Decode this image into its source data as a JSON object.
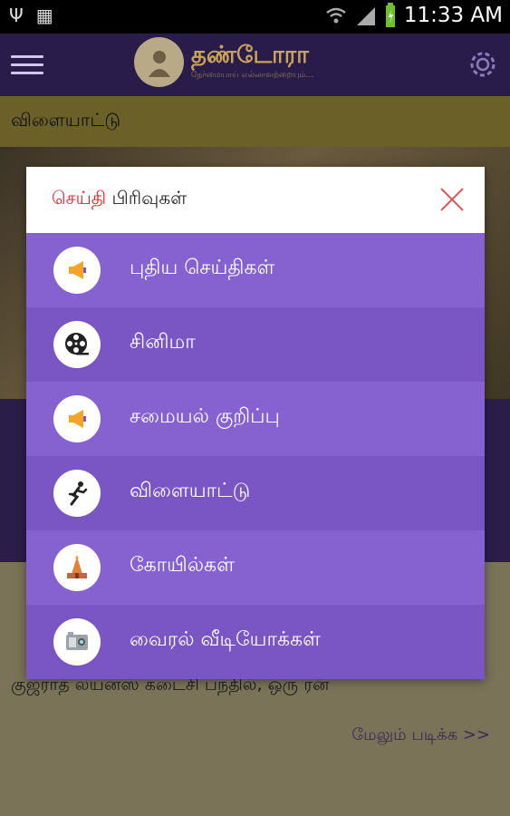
{
  "status_bar": {
    "time": "11:33 AM",
    "icons": [
      "usb-icon",
      "sim-icon",
      "wifi-icon",
      "signal-icon",
      "battery-icon"
    ]
  },
  "app_bar": {
    "logo_title": "தண்டோரா",
    "logo_tagline": "நேர்மையாய் எல்லாவற்றையும்...",
    "menu_icon": "hamburger-icon",
    "settings_icon": "gear-icon"
  },
  "category_bar": {
    "title": "விளையாட்டு"
  },
  "background": {
    "article_line": "குஜராத் லயன்ஸ் கடைசி பந்தில், ஒரு ரன்",
    "read_more": "மேலும் படிக்க >>"
  },
  "modal": {
    "title_highlight": "செய்தி",
    "title_rest": "பிரிவுகள்",
    "close_icon": "close-icon",
    "items": [
      {
        "label": "புதிய செய்திகள்",
        "icon": "megaphone-icon"
      },
      {
        "label": "சினிமா",
        "icon": "film-reel-icon"
      },
      {
        "label": "சமையல் குறிப்பு",
        "icon": "megaphone-icon"
      },
      {
        "label": "விளையாட்டு",
        "icon": "runner-icon"
      },
      {
        "label": "கோயில்கள்",
        "icon": "temple-icon"
      },
      {
        "label": "வைரல் வீடியோக்கள்",
        "icon": "video-camera-icon"
      }
    ]
  },
  "colors": {
    "app_bar": "#2a1c4a",
    "row_light": "#8562cf",
    "row_dark": "#7a55c4",
    "accent_red": "#d9262d",
    "icon_orange": "#f2a52a"
  }
}
